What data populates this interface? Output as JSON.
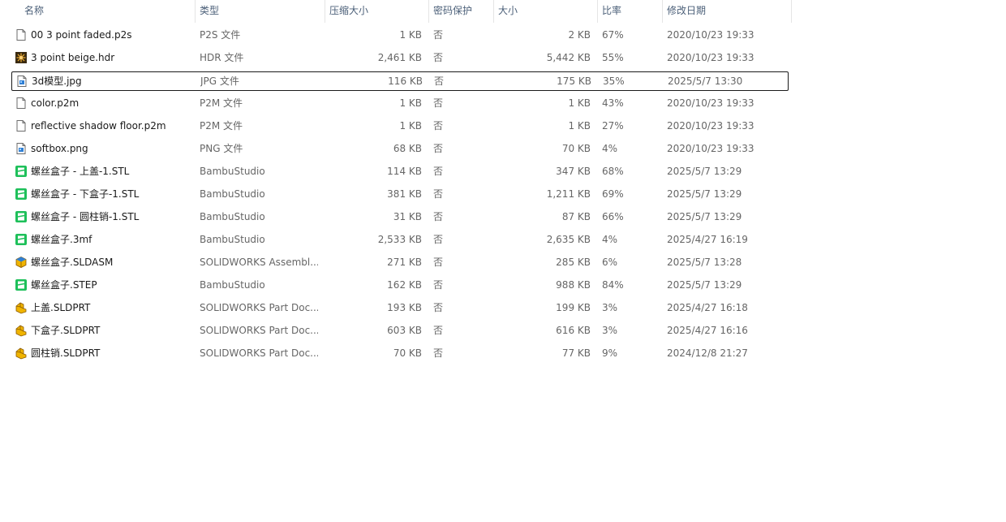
{
  "columns": {
    "name": "名称",
    "type": "类型",
    "compressed_size": "压缩大小",
    "password": "密码保护",
    "size": "大小",
    "ratio": "比率",
    "modified": "修改日期"
  },
  "sort_indicator": "^",
  "files": [
    {
      "icon": "blank-file-icon",
      "name": "00 3 point faded.p2s",
      "type": "P2S 文件",
      "csize": "1 KB",
      "prot": "否",
      "size": "2 KB",
      "ratio": "67%",
      "date": "2020/10/23 19:33"
    },
    {
      "icon": "hdr-image-icon",
      "name": "3 point beige.hdr",
      "type": "HDR 文件",
      "csize": "2,461 KB",
      "prot": "否",
      "size": "5,442 KB",
      "ratio": "55%",
      "date": "2020/10/23 19:33"
    },
    {
      "icon": "image-file-icon",
      "name": "3d模型.jpg",
      "type": "JPG 文件",
      "csize": "116 KB",
      "prot": "否",
      "size": "175 KB",
      "ratio": "35%",
      "date": "2025/5/7 13:30"
    },
    {
      "icon": "blank-file-icon",
      "name": "color.p2m",
      "type": "P2M 文件",
      "csize": "1 KB",
      "prot": "否",
      "size": "1 KB",
      "ratio": "43%",
      "date": "2020/10/23 19:33"
    },
    {
      "icon": "blank-file-icon",
      "name": "reflective shadow floor.p2m",
      "type": "P2M 文件",
      "csize": "1 KB",
      "prot": "否",
      "size": "1 KB",
      "ratio": "27%",
      "date": "2020/10/23 19:33"
    },
    {
      "icon": "image-file-icon",
      "name": "softbox.png",
      "type": "PNG 文件",
      "csize": "68 KB",
      "prot": "否",
      "size": "70 KB",
      "ratio": "4%",
      "date": "2020/10/23 19:33"
    },
    {
      "icon": "bambu-studio-icon",
      "name": "螺丝盒子 - 上盖-1.STL",
      "type": "BambuStudio",
      "csize": "114 KB",
      "prot": "否",
      "size": "347 KB",
      "ratio": "68%",
      "date": "2025/5/7 13:29"
    },
    {
      "icon": "bambu-studio-icon",
      "name": "螺丝盒子 - 下盒子-1.STL",
      "type": "BambuStudio",
      "csize": "381 KB",
      "prot": "否",
      "size": "1,211 KB",
      "ratio": "69%",
      "date": "2025/5/7 13:29"
    },
    {
      "icon": "bambu-studio-icon",
      "name": "螺丝盒子 - 圆柱销-1.STL",
      "type": "BambuStudio",
      "csize": "31 KB",
      "prot": "否",
      "size": "87 KB",
      "ratio": "66%",
      "date": "2025/5/7 13:29"
    },
    {
      "icon": "bambu-studio-icon",
      "name": "螺丝盒子.3mf",
      "type": "BambuStudio",
      "csize": "2,533 KB",
      "prot": "否",
      "size": "2,635 KB",
      "ratio": "4%",
      "date": "2025/4/27 16:19"
    },
    {
      "icon": "solidworks-assembly-icon",
      "name": "螺丝盒子.SLDASM",
      "type": "SOLIDWORKS Assembl...",
      "csize": "271 KB",
      "prot": "否",
      "size": "285 KB",
      "ratio": "6%",
      "date": "2025/5/7 13:28"
    },
    {
      "icon": "bambu-studio-icon",
      "name": "螺丝盒子.STEP",
      "type": "BambuStudio",
      "csize": "162 KB",
      "prot": "否",
      "size": "988 KB",
      "ratio": "84%",
      "date": "2025/5/7 13:29"
    },
    {
      "icon": "solidworks-part-icon",
      "name": "上盖.SLDPRT",
      "type": "SOLIDWORKS Part Doc...",
      "csize": "193 KB",
      "prot": "否",
      "size": "199 KB",
      "ratio": "3%",
      "date": "2025/4/27 16:18"
    },
    {
      "icon": "solidworks-part-icon",
      "name": "下盒子.SLDPRT",
      "type": "SOLIDWORKS Part Doc...",
      "csize": "603 KB",
      "prot": "否",
      "size": "616 KB",
      "ratio": "3%",
      "date": "2025/4/27 16:16"
    },
    {
      "icon": "solidworks-part-icon",
      "name": "圆柱销.SLDPRT",
      "type": "SOLIDWORKS Part Doc...",
      "csize": "70 KB",
      "prot": "否",
      "size": "77 KB",
      "ratio": "9%",
      "date": "2024/12/8 21:27"
    }
  ],
  "focused_row_index": 2,
  "colors": {
    "header_text": "#4c6079",
    "bambu_green": "#1ec05a",
    "solidworks_yellow": "#f0b400",
    "hdr_dark": "#3a2a10"
  }
}
